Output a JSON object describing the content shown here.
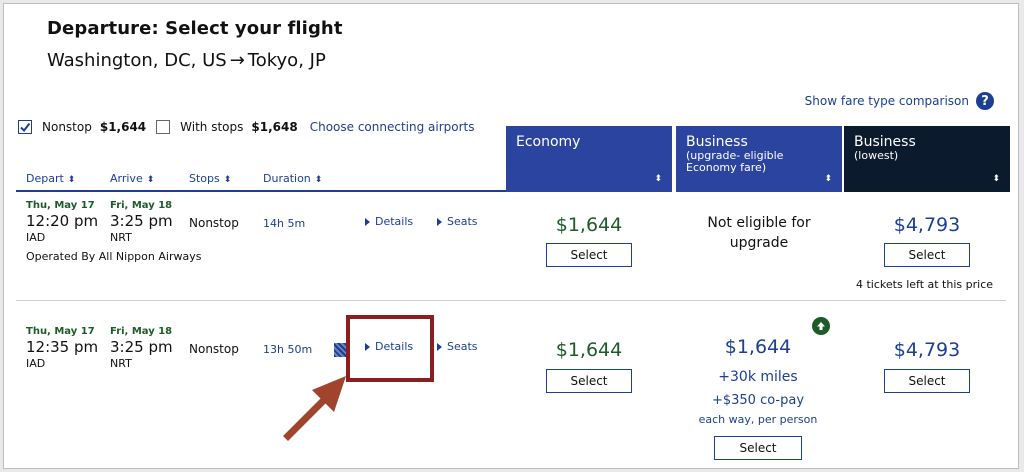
{
  "header": {
    "title": "Departure: Select your flight",
    "origin": "Washington, DC, US",
    "arrow": "→",
    "destination": "Tokyo, JP"
  },
  "fare_type_link": "Show fare type comparison",
  "help_icon": "?",
  "filters": {
    "nonstop_label": "Nonstop",
    "nonstop_price": "$1,644",
    "nonstop_checked": true,
    "with_stops_label": "With stops",
    "with_stops_price": "$1,648",
    "connecting_link": "Choose connecting airports"
  },
  "columns": {
    "depart": "Depart",
    "arrive": "Arrive",
    "stops": "Stops",
    "duration": "Duration",
    "sort_glyph": "⬍"
  },
  "cabins": [
    {
      "name": "Economy",
      "sub": "",
      "color": "#2a44a0"
    },
    {
      "name": "Business",
      "sub": "(upgrade- eligible Economy fare)",
      "color": "#2a44a0"
    },
    {
      "name": "Business",
      "sub": "(lowest)",
      "color": "#0c1a2e"
    }
  ],
  "flights": [
    {
      "dep_date": "Thu, May 17",
      "dep_time": "12:20 pm",
      "dep_airport": "IAD",
      "arr_date": "Fri, May 18",
      "arr_time": "3:25 pm",
      "arr_airport": "NRT",
      "stops": "Nonstop",
      "duration": "14h 5m",
      "details_label": "Details",
      "seats_label": "Seats",
      "operated_by": "Operated By All Nippon Airways",
      "economy_price": "$1,644",
      "select_label": "Select",
      "upgrade_text_1": "Not eligible for",
      "upgrade_text_2": "upgrade",
      "business_price": "$4,793",
      "tickets_left": "4 tickets left at this price"
    },
    {
      "dep_date": "Thu, May 17",
      "dep_time": "12:35 pm",
      "dep_airport": "IAD",
      "arr_date": "Fri, May 18",
      "arr_time": "3:25 pm",
      "arr_airport": "NRT",
      "stops": "Nonstop",
      "duration": "13h 50m",
      "details_label": "Details",
      "seats_label": "Seats",
      "economy_price": "$1,644",
      "select_label": "Select",
      "upgrade_price": "$1,644",
      "upgrade_miles": "+30k miles",
      "upgrade_copay": "+$350 co-pay",
      "upgrade_each": "each way, per person",
      "business_price": "$4,793"
    }
  ],
  "colors": {
    "link_blue": "#1c3f93",
    "price_green": "#1d5b2a",
    "highlight_red": "#8b1f1f"
  }
}
